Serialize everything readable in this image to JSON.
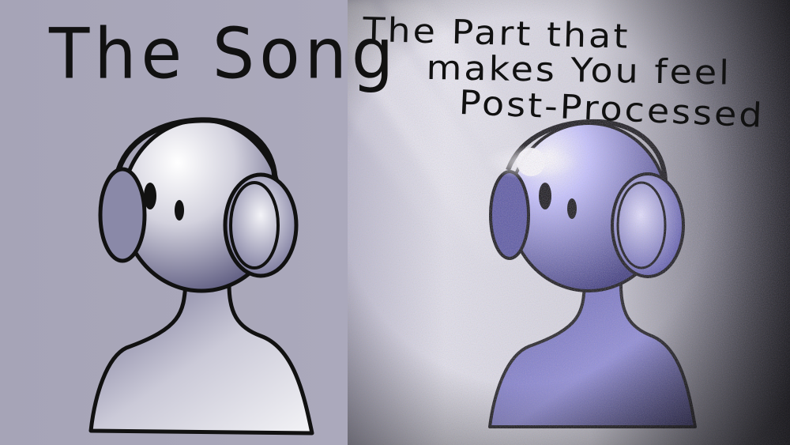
{
  "left_panel": {
    "caption": "The Song"
  },
  "right_panel": {
    "caption_lines": [
      "The Part that",
      "makes You feel",
      "Post-Processed"
    ]
  },
  "colors": {
    "left_background": "#a9a7b9",
    "right_background_light": "#e6e6ea",
    "right_background_dark": "#2a2a30",
    "figure_fill": "#c9c8d6",
    "figure_shadow": "#4a4870",
    "outline": "#111111",
    "glow": "#ffffff",
    "tint": "#8e8cff"
  }
}
